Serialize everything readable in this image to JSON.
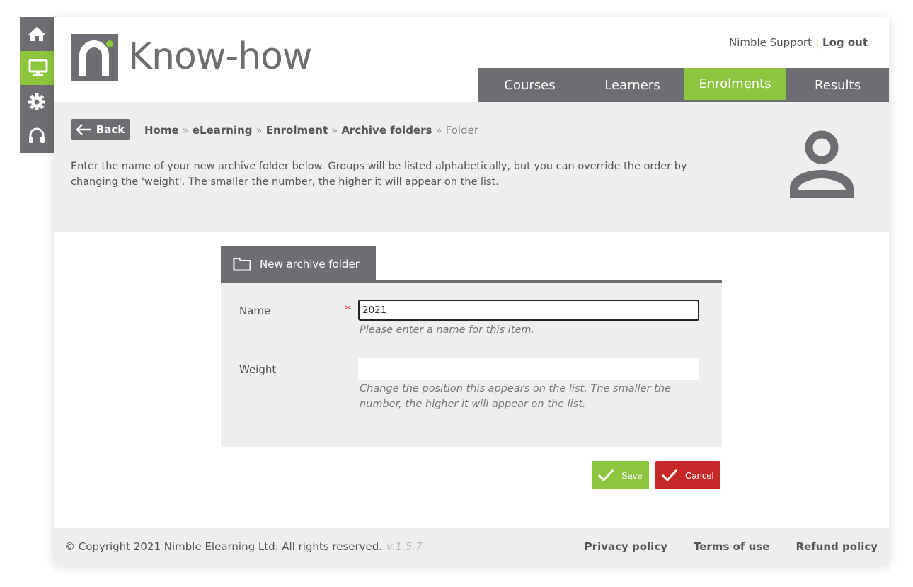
{
  "rail": {
    "items": [
      {
        "icon": "home-icon",
        "active": false
      },
      {
        "icon": "monitor-icon",
        "active": true
      },
      {
        "icon": "gear-icon",
        "active": false
      },
      {
        "icon": "headset-icon",
        "active": false
      }
    ]
  },
  "header": {
    "logo_text": "Know-how",
    "user_name": "Nimble Support",
    "separator": "|",
    "logout_label": "Log out"
  },
  "nav": {
    "tabs": [
      {
        "label": "Courses"
      },
      {
        "label": "Learners"
      },
      {
        "label": "Enrolments",
        "active": true
      },
      {
        "label": "Results"
      }
    ]
  },
  "intro": {
    "back_label": "Back",
    "breadcrumb": [
      {
        "label": "Home"
      },
      {
        "label": "eLearning"
      },
      {
        "label": "Enrolment"
      },
      {
        "label": "Archive folders"
      }
    ],
    "breadcrumb_sep": "»",
    "breadcrumb_current": "Folder",
    "text": "Enter the name of your new archive folder below. Groups will be listed alphabetically, but you can override the order by changing the 'weight'. The smaller the number, the higher it will appear on the list."
  },
  "form": {
    "tab_label": "New archive folder",
    "name": {
      "label": "Name",
      "required_mark": "*",
      "value": "2021",
      "help": "Please enter a name for this item."
    },
    "weight": {
      "label": "Weight",
      "value": "",
      "help": "Change the position this appears on the list. The smaller the number, the higher it will appear on the list."
    },
    "save_label": "Save",
    "cancel_label": "Cancel"
  },
  "footer": {
    "copyright": "© Copyright 2021 Nimble Elearning Ltd. All rights reserved.",
    "version": "v.1.5.7",
    "links": [
      {
        "label": "Privacy policy"
      },
      {
        "label": "Terms of use"
      },
      {
        "label": "Refund policy"
      }
    ]
  },
  "colors": {
    "accent": "#8cc63f",
    "dark_grey": "#6d6e71",
    "danger": "#c62828",
    "panel_bg": "#eeeeee"
  }
}
